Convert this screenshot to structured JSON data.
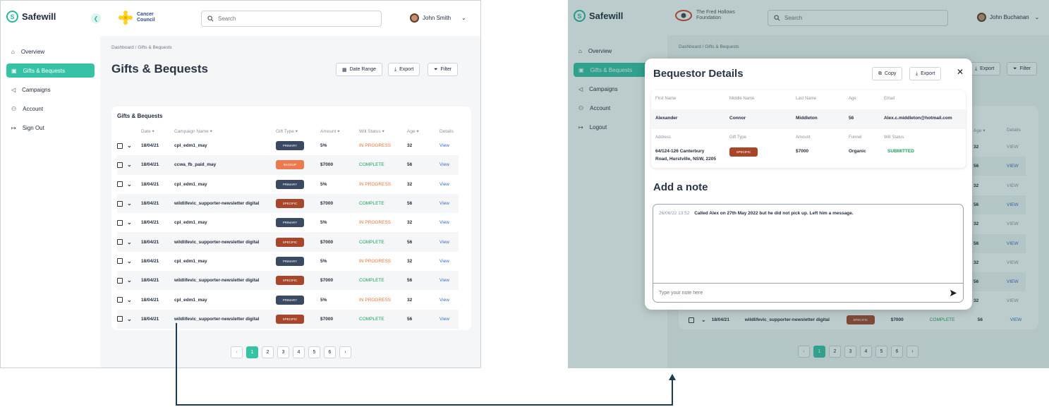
{
  "left": {
    "brand": "Safewill",
    "org_name": "Cancer Council",
    "search_placeholder": "Search",
    "user_name": "John Smith",
    "nav": [
      {
        "label": "Overview",
        "icon": "home-icon"
      },
      {
        "label": "Gifts & Bequests",
        "icon": "gift-icon",
        "active": true
      },
      {
        "label": "Campaigns",
        "icon": "megaphone-icon"
      },
      {
        "label": "Account",
        "icon": "user-icon"
      },
      {
        "label": "Sign Out",
        "icon": "sign-out-icon"
      }
    ],
    "breadcrumb": "Dashboard / Gifts & Bequests",
    "page_title": "Gifts & Bequests",
    "toolbar": {
      "date_range": "Date Range",
      "export": "Export",
      "filter": "Filter"
    },
    "table_title": "Gifts & Bequests",
    "columns": [
      "Date",
      "Campaign Name",
      "Gift Type",
      "Amount",
      "Will Status",
      "Age",
      "Details"
    ],
    "rows": [
      {
        "date": "18/04/21",
        "campaign": "cpl_edm1_may",
        "gift": "PRIMARY",
        "amount": "5%",
        "status": "IN PROGRESS",
        "age": "32",
        "details": "View"
      },
      {
        "date": "18/04/21",
        "campaign": "ccwa_fb_paid_may",
        "gift": "BACKUP",
        "amount": "$7000",
        "status": "COMPLETE",
        "age": "56",
        "details": "View"
      },
      {
        "date": "18/04/21",
        "campaign": "cpl_edm1_may",
        "gift": "PRIMARY",
        "amount": "5%",
        "status": "IN PROGRESS",
        "age": "32",
        "details": "View"
      },
      {
        "date": "18/04/21",
        "campaign": "wildlifevic_supporter-newsletter digital",
        "gift": "SPECIFIC",
        "amount": "$7000",
        "status": "COMPLETE",
        "age": "56",
        "details": "View"
      },
      {
        "date": "18/04/21",
        "campaign": "cpl_edm1_may",
        "gift": "PRIMARY",
        "amount": "5%",
        "status": "IN PROGRESS",
        "age": "32",
        "details": "View"
      },
      {
        "date": "18/04/21",
        "campaign": "wildlifevic_supporter-newsletter digital",
        "gift": "SPECIFIC",
        "amount": "$7000",
        "status": "COMPLETE",
        "age": "56",
        "details": "View"
      },
      {
        "date": "18/04/21",
        "campaign": "cpl_edm1_may",
        "gift": "PRIMARY",
        "amount": "5%",
        "status": "IN PROGRESS",
        "age": "32",
        "details": "View"
      },
      {
        "date": "18/04/21",
        "campaign": "wildlifevic_supporter-newsletter digital",
        "gift": "SPECIFIC",
        "amount": "$7000",
        "status": "COMPLETE",
        "age": "56",
        "details": "View"
      },
      {
        "date": "18/04/21",
        "campaign": "cpl_edm1_may",
        "gift": "PRIMARY",
        "amount": "5%",
        "status": "IN PROGRESS",
        "age": "32",
        "details": "View"
      },
      {
        "date": "18/04/21",
        "campaign": "wildlifevic_supporter-newsletter digital",
        "gift": "SPECIFIC",
        "amount": "$7000",
        "status": "COMPLETE",
        "age": "56",
        "details": "View"
      }
    ],
    "pages": [
      "1",
      "2",
      "3",
      "4",
      "5",
      "6"
    ],
    "current_page": "1"
  },
  "right": {
    "brand": "Safewill",
    "org_name": "The Fred Hollows Foundation",
    "search_placeholder": "Search",
    "user_name": "John Buchanan",
    "nav": [
      {
        "label": "Overview",
        "icon": "home-icon"
      },
      {
        "label": "Gifts & Bequests",
        "icon": "gift-icon",
        "active": true
      },
      {
        "label": "Campaigns",
        "icon": "megaphone-icon"
      },
      {
        "label": "Account",
        "icon": "user-icon"
      },
      {
        "label": "Logout",
        "icon": "sign-out-icon"
      }
    ],
    "breadcrumb": "Dashboard / Gifts & Bequests",
    "toolbar": {
      "export": "Export",
      "filter": "Filter"
    },
    "bg_columns": [
      "Age",
      "Details"
    ],
    "bg_rows": [
      {
        "age": "32",
        "details": "VIEW"
      },
      {
        "age": "56",
        "details": "VIEW"
      },
      {
        "age": "32",
        "details": "VIEW"
      },
      {
        "age": "56",
        "details": "VIEW"
      },
      {
        "age": "32",
        "details": "VIEW"
      },
      {
        "age": "56",
        "details": "VIEW"
      },
      {
        "age": "32",
        "details": "VIEW"
      },
      {
        "age": "56",
        "details": "VIEW"
      },
      {
        "age": "32",
        "details": "VIEW"
      }
    ],
    "last_row": {
      "date": "18/04/21",
      "campaign": "wildlifevic_supporter-newsletter digital",
      "gift": "SPECIFIC",
      "amount": "$7000",
      "status": "COMPLETE",
      "age": "56",
      "details": "VIEW"
    },
    "pages": [
      "1",
      "2",
      "3",
      "4",
      "5",
      "6"
    ],
    "modal": {
      "title": "Bequestor Details",
      "copy_label": "Copy",
      "export_label": "Export",
      "labels1": [
        "First Name",
        "Middle Name",
        "Last Name",
        "Age",
        "Email"
      ],
      "values1": [
        "Alexander",
        "Connor",
        "Middleton",
        "56",
        "Alex.c.middleton@hotmail.com"
      ],
      "labels2": [
        "Address",
        "Gift Type",
        "Amount",
        "Funnel",
        "Will Status"
      ],
      "address_line1": "64/124-126 Canterbury",
      "address_line2": "Road, Hurstville, NSW, 2205",
      "gift_type": "SPECIFIC",
      "amount": "$7000",
      "funnel": "Organic",
      "will_status": "SUBMITTED",
      "note_title": "Add a note",
      "note_timestamp": "26/06/22 13:52",
      "note_text": "Called Alex on 27th May 2022 but he did not pick up. Left him a message.",
      "note_placeholder": "Type your note here"
    }
  },
  "colors": {
    "accent": "#36c3a5",
    "primary_pill": "#3b4a63",
    "backup_pill": "#ec7a4f",
    "specific_pill": "#a8462b",
    "in_progress": "#e8733a",
    "complete": "#1aa35a",
    "link": "#3b6ec9"
  }
}
